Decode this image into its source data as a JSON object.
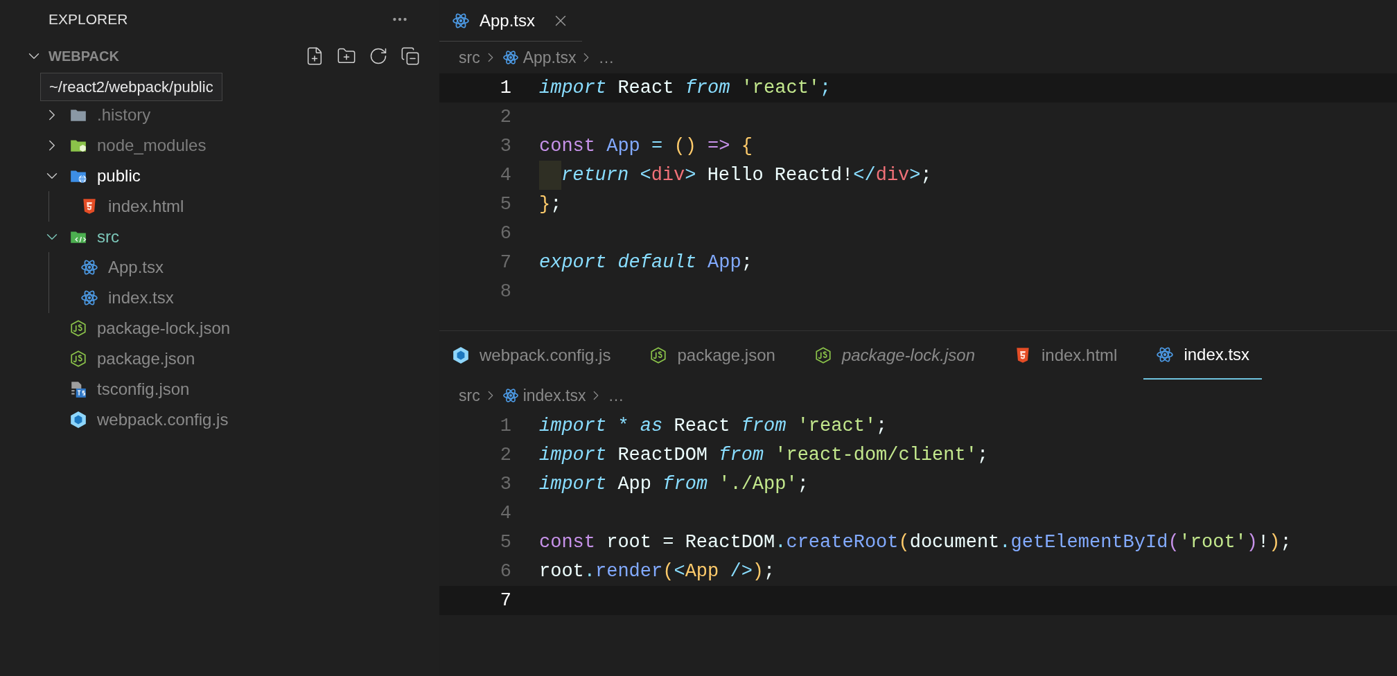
{
  "sidebar": {
    "title": "EXPLORER",
    "section": {
      "title": "WEBPACK",
      "expanded": true
    },
    "tooltip": "~/react2/webpack/public",
    "tree": [
      {
        "name": ".history",
        "kind": "folder-plain",
        "expanded": false,
        "color": "#7d7d7d"
      },
      {
        "name": "node_modules",
        "kind": "folder-node",
        "expanded": false,
        "color": "#7d7d7d"
      },
      {
        "name": "public",
        "kind": "folder-public",
        "expanded": true,
        "color": "#ffffff",
        "children": [
          {
            "name": "index.html",
            "kind": "html",
            "color": "#8a8a8a"
          }
        ]
      },
      {
        "name": "src",
        "kind": "folder-src",
        "expanded": true,
        "color": "#7cc7b9",
        "children": [
          {
            "name": "App.tsx",
            "kind": "react",
            "color": "#8a8a8a"
          },
          {
            "name": "index.tsx",
            "kind": "react",
            "color": "#8a8a8a"
          }
        ]
      },
      {
        "name": "package-lock.json",
        "kind": "json",
        "color": "#8a8a8a"
      },
      {
        "name": "package.json",
        "kind": "json",
        "color": "#8a8a8a"
      },
      {
        "name": "tsconfig.json",
        "kind": "tsconfig",
        "color": "#8a8a8a"
      },
      {
        "name": "webpack.config.js",
        "kind": "webpack",
        "color": "#8a8a8a"
      }
    ]
  },
  "editor_groups": [
    {
      "tabs": [
        {
          "label": "App.tsx",
          "kind": "react",
          "selected": true,
          "preview": false,
          "closable": true
        }
      ],
      "breadcrumb": [
        {
          "text": "src",
          "kind": "folder"
        },
        {
          "text": "App.tsx",
          "kind": "react"
        },
        {
          "text": "…",
          "kind": "more"
        }
      ],
      "lines": [
        {
          "number": "1",
          "current": true,
          "tokens": [
            {
              "text": "import",
              "kind": "kw"
            },
            {
              "text": " React ",
              "kind": "plain"
            },
            {
              "text": "from",
              "kind": "kw"
            },
            {
              "text": " 'react'",
              "kind": "str"
            },
            {
              "text": ";",
              "kind": "punct"
            }
          ]
        },
        {
          "number": "2",
          "current": false
        },
        {
          "number": "3",
          "current": false,
          "tokens": [
            {
              "text": "const",
              "kind": "decl"
            },
            {
              "text": " App",
              "kind": "fn"
            },
            {
              "text": " =",
              "kind": "punct"
            },
            {
              "text": " ()",
              "kind": "brace"
            },
            {
              "text": " =>",
              "kind": "decl"
            },
            {
              "text": " {",
              "kind": "brace"
            }
          ]
        },
        {
          "number": "4",
          "current": false,
          "indent_guide": true,
          "tokens": [
            {
              "text": "return",
              "kind": "kw"
            },
            {
              "text": " <",
              "kind": "punct"
            },
            {
              "text": "div",
              "kind": "tag"
            },
            {
              "text": ">",
              "kind": "punct"
            },
            {
              "text": " Hello Reactd!",
              "kind": "plain"
            },
            {
              "text": "</",
              "kind": "punct"
            },
            {
              "text": "div",
              "kind": "tag"
            },
            {
              "text": ">",
              "kind": "punct"
            },
            {
              "text": ";",
              "kind": "plain"
            }
          ]
        },
        {
          "number": "5",
          "current": false,
          "tokens": [
            {
              "text": "}",
              "kind": "brace"
            },
            {
              "text": ";",
              "kind": "plain"
            }
          ]
        },
        {
          "number": "6",
          "current": false
        },
        {
          "number": "7",
          "current": false,
          "tokens": [
            {
              "text": "export",
              "kind": "kw"
            },
            {
              "text": " default",
              "kind": "kw"
            },
            {
              "text": " App",
              "kind": "fn"
            },
            {
              "text": ";",
              "kind": "plain"
            }
          ]
        },
        {
          "number": "8",
          "current": false
        }
      ]
    },
    {
      "tabs": [
        {
          "label": "webpack.config.js",
          "kind": "webpack",
          "selected": false,
          "preview": false
        },
        {
          "label": "package.json",
          "kind": "json",
          "selected": false,
          "preview": false
        },
        {
          "label": "package-lock.json",
          "kind": "json",
          "selected": false,
          "preview": true
        },
        {
          "label": "index.html",
          "kind": "html",
          "selected": false,
          "preview": false
        },
        {
          "label": "index.tsx",
          "kind": "react",
          "selected": true,
          "preview": false
        }
      ],
      "breadcrumb": [
        {
          "text": "src",
          "kind": "folder"
        },
        {
          "text": "index.tsx",
          "kind": "react"
        },
        {
          "text": "…",
          "kind": "more"
        }
      ],
      "lines": [
        {
          "number": "1",
          "current": false,
          "tokens": [
            {
              "text": "import",
              "kind": "kw"
            },
            {
              "text": " *",
              "kind": "punct"
            },
            {
              "text": " as",
              "kind": "kw"
            },
            {
              "text": " React ",
              "kind": "plain"
            },
            {
              "text": "from",
              "kind": "kw"
            },
            {
              "text": " 'react'",
              "kind": "str"
            },
            {
              "text": ";",
              "kind": "plain"
            }
          ]
        },
        {
          "number": "2",
          "current": false,
          "tokens": [
            {
              "text": "import",
              "kind": "kw"
            },
            {
              "text": " ReactDOM ",
              "kind": "plain"
            },
            {
              "text": "from",
              "kind": "kw"
            },
            {
              "text": " 'react-dom/client'",
              "kind": "str"
            },
            {
              "text": ";",
              "kind": "plain"
            }
          ]
        },
        {
          "number": "3",
          "current": false,
          "tokens": [
            {
              "text": "import",
              "kind": "kw"
            },
            {
              "text": " App ",
              "kind": "plain"
            },
            {
              "text": "from",
              "kind": "kw"
            },
            {
              "text": " './App'",
              "kind": "str"
            },
            {
              "text": ";",
              "kind": "plain"
            }
          ]
        },
        {
          "number": "4",
          "current": false
        },
        {
          "number": "5",
          "current": false,
          "tokens": [
            {
              "text": "const",
              "kind": "decl"
            },
            {
              "text": " root = ReactDOM",
              "kind": "plain"
            },
            {
              "text": ".",
              "kind": "punct"
            },
            {
              "text": "createRoot",
              "kind": "fn"
            },
            {
              "text": "(",
              "kind": "brace"
            },
            {
              "text": "document",
              "kind": "plain"
            },
            {
              "text": ".",
              "kind": "punct"
            },
            {
              "text": "getElementById",
              "kind": "fn"
            },
            {
              "text": "(",
              "kind": "paren2"
            },
            {
              "text": "'root'",
              "kind": "str"
            },
            {
              "text": ")",
              "kind": "paren2"
            },
            {
              "text": "!",
              "kind": "plain"
            },
            {
              "text": ")",
              "kind": "brace"
            },
            {
              "text": ";",
              "kind": "plain"
            }
          ]
        },
        {
          "number": "6",
          "current": false,
          "tokens": [
            {
              "text": "root",
              "kind": "plain"
            },
            {
              "text": ".",
              "kind": "punct"
            },
            {
              "text": "render",
              "kind": "fn"
            },
            {
              "text": "(",
              "kind": "brace"
            },
            {
              "text": "<",
              "kind": "punct"
            },
            {
              "text": "App",
              "kind": "brace"
            },
            {
              "text": " />",
              "kind": "punct"
            },
            {
              "text": ")",
              "kind": "brace"
            },
            {
              "text": ";",
              "kind": "plain"
            }
          ]
        },
        {
          "number": "7",
          "current": true
        }
      ]
    }
  ]
}
